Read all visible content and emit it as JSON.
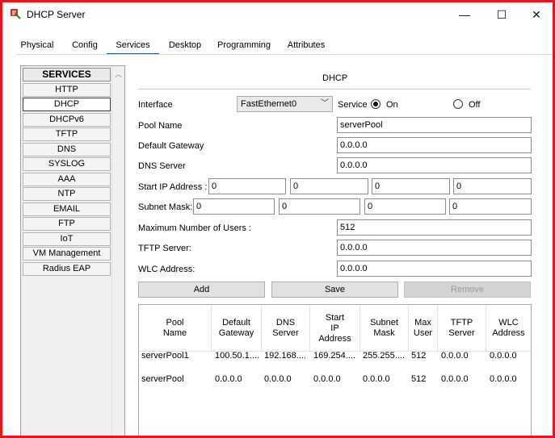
{
  "window": {
    "title": "DHCP Server",
    "controls": {
      "minimize": "—",
      "maximize": "☐",
      "close": "✕"
    }
  },
  "tabs": [
    "Physical",
    "Config",
    "Services",
    "Desktop",
    "Programming",
    "Attributes"
  ],
  "active_tab": "Services",
  "services": {
    "header": "SERVICES",
    "items": [
      "HTTP",
      "DHCP",
      "DHCPv6",
      "TFTP",
      "DNS",
      "SYSLOG",
      "AAA",
      "NTP",
      "EMAIL",
      "FTP",
      "IoT",
      "VM Management",
      "Radius EAP"
    ],
    "selected": "DHCP"
  },
  "dhcp": {
    "title": "DHCP",
    "interface_label": "Interface",
    "interface_value": "FastEthernet0",
    "service_label": "Service",
    "on_label": "On",
    "off_label": "Off",
    "service_state": "On",
    "pool_name_label": "Pool Name",
    "pool_name_value": "serverPool",
    "default_gateway_label": "Default Gateway",
    "default_gateway_value": "0.0.0.0",
    "dns_server_label": "DNS Server",
    "dns_server_value": "0.0.0.0",
    "start_ip_label": "Start IP Address :",
    "start_ip": [
      "0",
      "0",
      "0",
      "0"
    ],
    "subnet_mask_label": "Subnet Mask:",
    "subnet_mask": [
      "0",
      "0",
      "0",
      "0"
    ],
    "max_users_label": "Maximum Number of Users :",
    "max_users_value": "512",
    "tftp_label": "TFTP Server:",
    "tftp_value": "0.0.0.0",
    "wlc_label": "WLC Address:",
    "wlc_value": "0.0.0.0",
    "buttons": {
      "add": "Add",
      "save": "Save",
      "remove": "Remove"
    }
  },
  "table": {
    "headers": [
      [
        "Pool",
        "Name"
      ],
      [
        "Default",
        "Gateway"
      ],
      [
        "DNS",
        "Server"
      ],
      [
        "Start",
        "IP",
        "Address"
      ],
      [
        "Subnet",
        "Mask"
      ],
      [
        "Max",
        "User"
      ],
      [
        "TFTP",
        "Server"
      ],
      [
        "WLC",
        "Address"
      ]
    ],
    "rows": [
      [
        "serverPool1",
        "100.50.1....",
        "192.168....",
        "169.254....",
        "255.255....",
        "512",
        "0.0.0.0",
        "0.0.0.0"
      ],
      [
        "serverPool",
        "0.0.0.0",
        "0.0.0.0",
        "0.0.0.0",
        "0.0.0.0",
        "512",
        "0.0.0.0",
        "0.0.0.0"
      ]
    ]
  }
}
